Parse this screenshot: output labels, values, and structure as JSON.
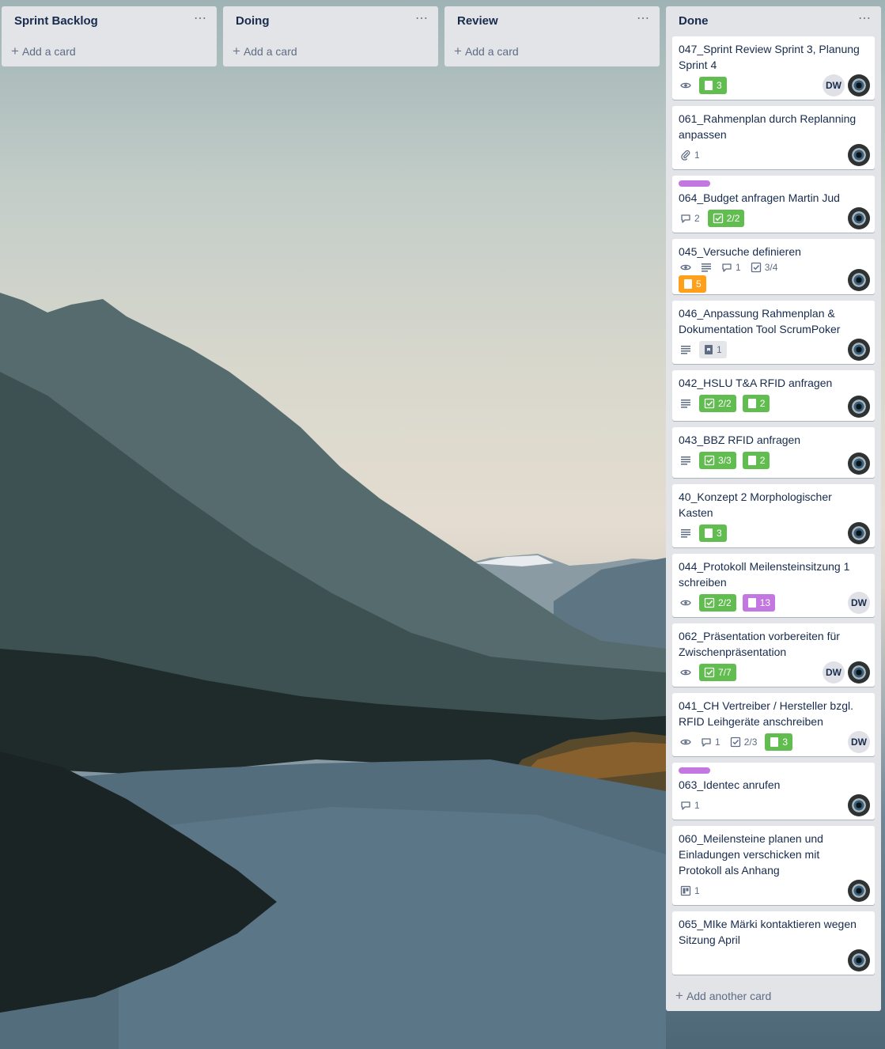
{
  "colors": {
    "label_purple": "#c377e0",
    "badge_green": "#61bd4f",
    "badge_orange": "#ff9f1a",
    "badge_purple": "#c377e0",
    "list_bg": "#e2e4e8"
  },
  "lists": [
    {
      "title": "Sprint Backlog",
      "menu_icon": "ellipsis-icon",
      "add_label": "Add a card"
    },
    {
      "title": "Doing",
      "menu_icon": "ellipsis-icon",
      "add_label": "Add a card"
    },
    {
      "title": "Review",
      "menu_icon": "ellipsis-icon",
      "add_label": "Add a card"
    },
    {
      "title": "Done",
      "menu_icon": "ellipsis-icon",
      "add_another_label": "Add another card",
      "cards": [
        {
          "title": "047_Sprint Review Sprint 3, Planung Sprint 4",
          "badges": [
            {
              "kind": "watch",
              "icon": "eye-icon"
            },
            {
              "kind": "points",
              "color": "green",
              "icon": "card-icon",
              "count": "3"
            }
          ],
          "members": [
            {
              "type": "initials",
              "text": "DW"
            },
            {
              "type": "photo"
            }
          ]
        },
        {
          "title": "061_Rahmenplan durch Replanning anpassen",
          "badges": [
            {
              "kind": "attachment",
              "icon": "paperclip-icon",
              "count": "1"
            }
          ],
          "members": [
            {
              "type": "photo"
            }
          ]
        },
        {
          "label": "purple",
          "title": "064_Budget anfragen Martin Jud",
          "badges": [
            {
              "kind": "comments",
              "icon": "comment-icon",
              "count": "2"
            },
            {
              "kind": "checklist",
              "color": "green",
              "icon": "checkbox-icon",
              "count": "2/2"
            }
          ],
          "members": [
            {
              "type": "photo"
            }
          ]
        },
        {
          "title": "045_Versuche definieren",
          "badges": [
            {
              "kind": "watch",
              "icon": "eye-icon"
            },
            {
              "kind": "description",
              "icon": "description-icon"
            },
            {
              "kind": "comments",
              "icon": "comment-icon",
              "count": "1"
            },
            {
              "kind": "checklist",
              "icon": "checkbox-icon",
              "count": "3/4"
            },
            {
              "kind": "points",
              "color": "orange",
              "icon": "card-icon",
              "count": "5"
            }
          ],
          "members": [
            {
              "type": "photo"
            }
          ]
        },
        {
          "title": "046_Anpassung Rahmenplan & Dokumentation Tool ScrumPoker",
          "badges": [
            {
              "kind": "description",
              "icon": "description-icon"
            },
            {
              "kind": "points",
              "color": "grey",
              "icon": "card-icon",
              "count": "1"
            }
          ],
          "members": [
            {
              "type": "photo"
            }
          ]
        },
        {
          "title": "042_HSLU T&A RFID anfragen",
          "badges": [
            {
              "kind": "description",
              "icon": "description-icon"
            },
            {
              "kind": "checklist",
              "color": "green",
              "icon": "checkbox-icon",
              "count": "2/2"
            },
            {
              "kind": "points",
              "color": "green",
              "icon": "card-icon",
              "count": "2"
            }
          ],
          "members": [
            {
              "type": "photo"
            }
          ]
        },
        {
          "title": "043_BBZ RFID anfragen",
          "badges": [
            {
              "kind": "description",
              "icon": "description-icon"
            },
            {
              "kind": "checklist",
              "color": "green",
              "icon": "checkbox-icon",
              "count": "3/3"
            },
            {
              "kind": "points",
              "color": "green",
              "icon": "card-icon",
              "count": "2"
            }
          ],
          "members": [
            {
              "type": "photo"
            }
          ]
        },
        {
          "title": "40_Konzept 2 Morphologischer Kasten",
          "badges": [
            {
              "kind": "description",
              "icon": "description-icon"
            },
            {
              "kind": "points",
              "color": "green",
              "icon": "card-icon",
              "count": "3"
            }
          ],
          "members": [
            {
              "type": "photo"
            }
          ]
        },
        {
          "title": "044_Protokoll Meilensteinsitzung 1 schreiben",
          "badges": [
            {
              "kind": "watch",
              "icon": "eye-icon"
            },
            {
              "kind": "checklist",
              "color": "green",
              "icon": "checkbox-icon",
              "count": "2/2"
            },
            {
              "kind": "points",
              "color": "purple",
              "icon": "card-icon",
              "count": "13"
            }
          ],
          "members": [
            {
              "type": "initials",
              "text": "DW"
            }
          ]
        },
        {
          "title": "062_Präsentation vorbereiten für Zwischenpräsentation",
          "badges": [
            {
              "kind": "watch",
              "icon": "eye-icon"
            },
            {
              "kind": "checklist",
              "color": "green",
              "icon": "checkbox-icon",
              "count": "7/7"
            }
          ],
          "members": [
            {
              "type": "initials",
              "text": "DW"
            },
            {
              "type": "photo"
            }
          ]
        },
        {
          "title": "041_CH Vertreiber / Hersteller bzgl. RFID Leihgeräte anschreiben",
          "badges": [
            {
              "kind": "watch",
              "icon": "eye-icon"
            },
            {
              "kind": "comments",
              "icon": "comment-icon",
              "count": "1"
            },
            {
              "kind": "checklist",
              "icon": "checkbox-icon",
              "count": "2/3"
            },
            {
              "kind": "points",
              "color": "green",
              "icon": "card-icon",
              "count": "3"
            }
          ],
          "members": [
            {
              "type": "initials",
              "text": "DW"
            }
          ]
        },
        {
          "label": "purple",
          "title": "063_Identec anrufen",
          "badges": [
            {
              "kind": "comments",
              "icon": "comment-icon",
              "count": "1"
            }
          ],
          "members": [
            {
              "type": "photo"
            }
          ]
        },
        {
          "title": "060_Meilensteine planen und Einladungen verschicken mit Protokoll als Anhang",
          "badges": [
            {
              "kind": "board",
              "icon": "trello-board-icon",
              "count": "1"
            }
          ],
          "members": [
            {
              "type": "photo"
            }
          ]
        },
        {
          "title": "065_MIke Märki kontaktieren wegen Sitzung April",
          "badges": [],
          "members": [
            {
              "type": "photo"
            }
          ]
        }
      ]
    }
  ]
}
